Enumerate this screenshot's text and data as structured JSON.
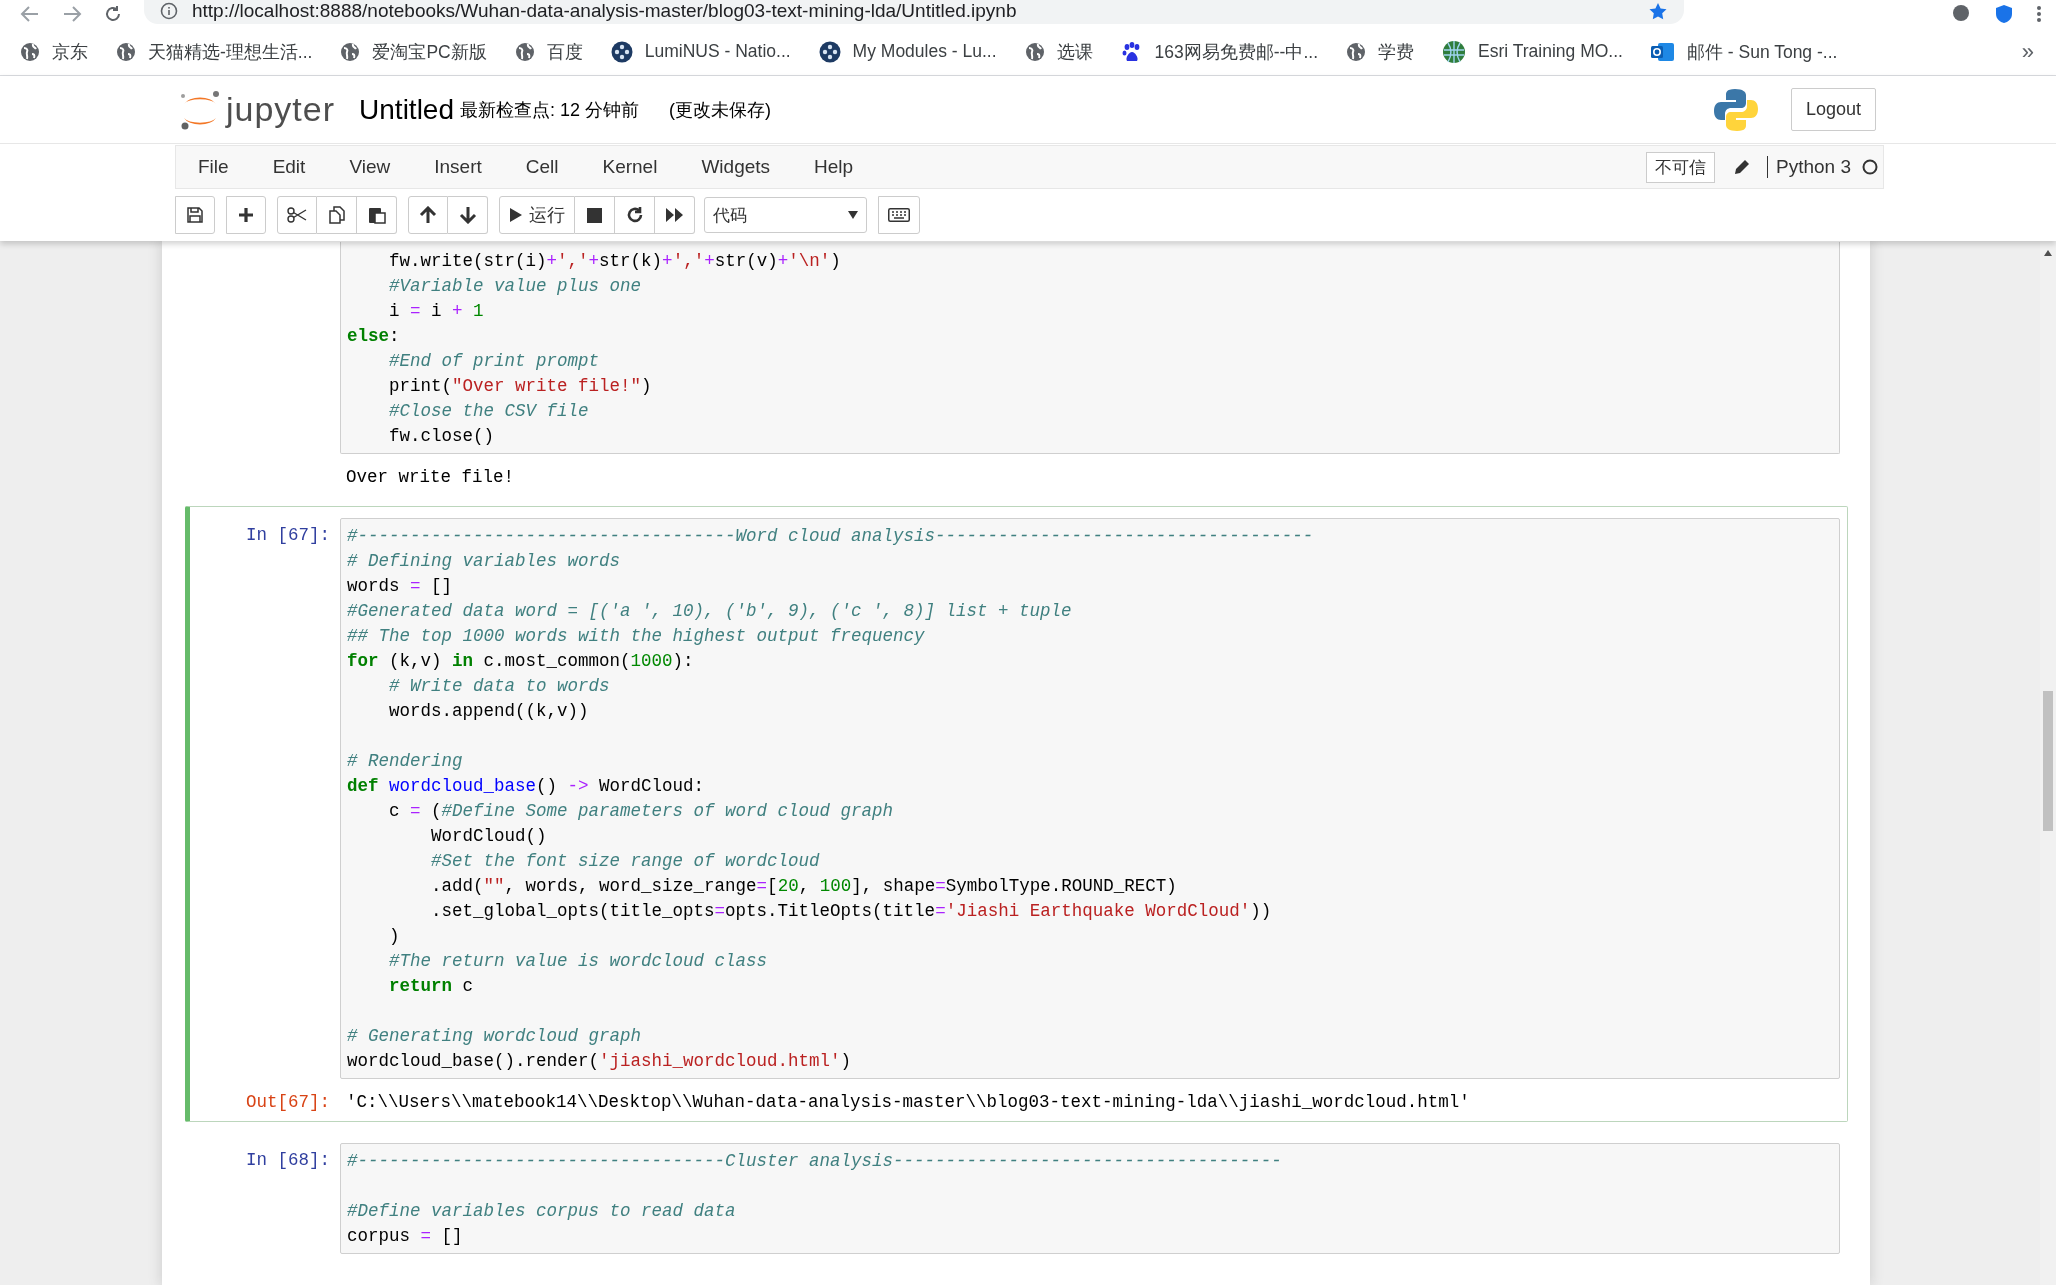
{
  "browser": {
    "url": "http://localhost:8888/notebooks/Wuhan-data-analysis-master/blog03-text-mining-lda/Untitled.ipynb",
    "bookmarks": [
      "京东",
      "天猫精选-理想生活...",
      "爱淘宝PC新版",
      "百度",
      "LumiNUS - Natio...",
      "My Modules - Lu...",
      "选课",
      "163网易免费邮--中...",
      "学费",
      "Esri Training MO...",
      "邮件 - Sun Tong -..."
    ],
    "overflow": "»"
  },
  "header": {
    "logo_text": "jupyter",
    "notebook_name": "Untitled",
    "checkpoint": "最新检查点: 12 分钟前",
    "autosave": "(更改未保存)",
    "logout": "Logout"
  },
  "menu": [
    "File",
    "Edit",
    "View",
    "Insert",
    "Cell",
    "Kernel",
    "Widgets",
    "Help"
  ],
  "kernel": {
    "trust": "不可信",
    "name": "Python 3",
    "busy": false
  },
  "toolbar": {
    "run_label": "运行",
    "cell_type": "代码"
  },
  "cells": [
    {
      "selected": false,
      "lines": [
        {
          "kind": "code",
          "tokens": [
            {
              "kind": "plain",
              "text": "    fw.write(str(i)"
            },
            {
              "kind": "op",
              "text": "+"
            },
            {
              "kind": "string",
              "text": "','"
            },
            {
              "kind": "op",
              "text": "+"
            },
            {
              "kind": "plain",
              "text": "str(k)"
            },
            {
              "kind": "op",
              "text": "+"
            },
            {
              "kind": "string",
              "text": "','"
            },
            {
              "kind": "op",
              "text": "+"
            },
            {
              "kind": "plain",
              "text": "str(v)"
            },
            {
              "kind": "op",
              "text": "+"
            },
            {
              "kind": "string",
              "text": "'\\n'"
            },
            {
              "kind": "plain",
              "text": ")"
            }
          ]
        },
        {
          "kind": "code",
          "tokens": [
            {
              "kind": "comment",
              "text": "    #Variable value plus one"
            }
          ]
        },
        {
          "kind": "code",
          "tokens": [
            {
              "kind": "plain",
              "text": "    i "
            },
            {
              "kind": "op",
              "text": "="
            },
            {
              "kind": "plain",
              "text": " i "
            },
            {
              "kind": "op",
              "text": "+"
            },
            {
              "kind": "number",
              "text": " 1"
            }
          ]
        },
        {
          "kind": "code",
          "tokens": [
            {
              "kind": "keyword",
              "text": "else"
            },
            {
              "kind": "plain",
              "text": ":"
            }
          ]
        },
        {
          "kind": "code",
          "tokens": [
            {
              "kind": "comment",
              "text": "    #End of print prompt"
            }
          ]
        },
        {
          "kind": "code",
          "tokens": [
            {
              "kind": "plain",
              "text": "    print("
            },
            {
              "kind": "string",
              "text": "\"Over write file!\""
            },
            {
              "kind": "plain",
              "text": ")"
            }
          ]
        },
        {
          "kind": "code",
          "tokens": [
            {
              "kind": "comment",
              "text": "    #Close the CSV file"
            }
          ]
        },
        {
          "kind": "code",
          "tokens": [
            {
              "kind": "plain",
              "text": "    fw.close()"
            }
          ]
        }
      ],
      "output": "Over write file!"
    },
    {
      "selected": true,
      "input_prompt": "In [67]:",
      "lines": [
        {
          "kind": "code",
          "tokens": [
            {
              "kind": "comment",
              "text": "#------------------------------------Word cloud analysis------------------------------------"
            }
          ]
        },
        {
          "kind": "code",
          "tokens": [
            {
              "kind": "comment",
              "text": "# Defining variables words"
            }
          ]
        },
        {
          "kind": "code",
          "tokens": [
            {
              "kind": "plain",
              "text": "words "
            },
            {
              "kind": "op",
              "text": "="
            },
            {
              "kind": "plain",
              "text": " []"
            }
          ]
        },
        {
          "kind": "code",
          "tokens": [
            {
              "kind": "comment",
              "text": "#Generated data word = [('a ', 10), ('b', 9), ('c ', 8)] list + tuple"
            }
          ]
        },
        {
          "kind": "code",
          "tokens": [
            {
              "kind": "comment",
              "text": "## The top 1000 words with the highest output frequency"
            }
          ]
        },
        {
          "kind": "code",
          "tokens": [
            {
              "kind": "keyword",
              "text": "for"
            },
            {
              "kind": "plain",
              "text": " (k,v) "
            },
            {
              "kind": "keyword",
              "text": "in"
            },
            {
              "kind": "plain",
              "text": " c.most_common("
            },
            {
              "kind": "number",
              "text": "1000"
            },
            {
              "kind": "plain",
              "text": "):"
            }
          ]
        },
        {
          "kind": "code",
          "tokens": [
            {
              "kind": "comment",
              "text": "    # Write data to words"
            }
          ]
        },
        {
          "kind": "code",
          "tokens": [
            {
              "kind": "plain",
              "text": "    words.append((k,v))"
            }
          ]
        },
        {
          "kind": "blank"
        },
        {
          "kind": "code",
          "tokens": [
            {
              "kind": "comment",
              "text": "# Rendering"
            }
          ]
        },
        {
          "kind": "code",
          "tokens": [
            {
              "kind": "keyword",
              "text": "def "
            },
            {
              "kind": "name",
              "text": "wordcloud_base"
            },
            {
              "kind": "plain",
              "text": "() "
            },
            {
              "kind": "op",
              "text": "->"
            },
            {
              "kind": "plain",
              "text": " WordCloud:"
            }
          ]
        },
        {
          "kind": "code",
          "tokens": [
            {
              "kind": "plain",
              "text": "    c "
            },
            {
              "kind": "op",
              "text": "="
            },
            {
              "kind": "plain",
              "text": " ("
            },
            {
              "kind": "comment",
              "text": "#Define Some parameters of word cloud graph"
            }
          ]
        },
        {
          "kind": "code",
          "tokens": [
            {
              "kind": "plain",
              "text": "        WordCloud()"
            }
          ]
        },
        {
          "kind": "code",
          "tokens": [
            {
              "kind": "comment",
              "text": "        #Set the font size range of wordcloud"
            }
          ]
        },
        {
          "kind": "code",
          "tokens": [
            {
              "kind": "plain",
              "text": "        .add("
            },
            {
              "kind": "string",
              "text": "\"\""
            },
            {
              "kind": "plain",
              "text": ", words, word_size_range"
            },
            {
              "kind": "op",
              "text": "="
            },
            {
              "kind": "plain",
              "text": "["
            },
            {
              "kind": "number",
              "text": "20"
            },
            {
              "kind": "plain",
              "text": ", "
            },
            {
              "kind": "number",
              "text": "100"
            },
            {
              "kind": "plain",
              "text": "], shape"
            },
            {
              "kind": "op",
              "text": "="
            },
            {
              "kind": "plain",
              "text": "SymbolType.ROUND_RECT)"
            }
          ]
        },
        {
          "kind": "code",
          "tokens": [
            {
              "kind": "plain",
              "text": "        .set_global_opts(title_opts"
            },
            {
              "kind": "op",
              "text": "="
            },
            {
              "kind": "plain",
              "text": "opts.TitleOpts(title"
            },
            {
              "kind": "op",
              "text": "="
            },
            {
              "kind": "string",
              "text": "'Jiashi Earthquake WordCloud'"
            },
            {
              "kind": "plain",
              "text": "))"
            }
          ]
        },
        {
          "kind": "code",
          "tokens": [
            {
              "kind": "plain",
              "text": "    )"
            }
          ]
        },
        {
          "kind": "code",
          "tokens": [
            {
              "kind": "comment",
              "text": "    #The return value is wordcloud class"
            }
          ]
        },
        {
          "kind": "code",
          "tokens": [
            {
              "kind": "keyword",
              "text": "    return"
            },
            {
              "kind": "plain",
              "text": " c"
            }
          ]
        },
        {
          "kind": "blank"
        },
        {
          "kind": "code",
          "tokens": [
            {
              "kind": "comment",
              "text": "# Generating wordcloud graph"
            }
          ]
        },
        {
          "kind": "code",
          "tokens": [
            {
              "kind": "plain",
              "text": "wordcloud_base().render("
            },
            {
              "kind": "string",
              "text": "'jiashi_wordcloud.html'"
            },
            {
              "kind": "plain",
              "text": ")"
            }
          ]
        }
      ],
      "output_prompt": "Out[67]:",
      "output": "'C:\\\\Users\\\\matebook14\\\\Desktop\\\\Wuhan-data-analysis-master\\\\blog03-text-mining-lda\\\\jiashi_wordcloud.html'"
    },
    {
      "selected": false,
      "input_prompt": "In [68]:",
      "lines": [
        {
          "kind": "code",
          "tokens": [
            {
              "kind": "comment",
              "text": "#-----------------------------------Cluster analysis-------------------------------------"
            }
          ]
        },
        {
          "kind": "blank"
        },
        {
          "kind": "code",
          "tokens": [
            {
              "kind": "comment",
              "text": "#Define variables corpus to read data"
            }
          ]
        },
        {
          "kind": "code",
          "tokens": [
            {
              "kind": "plain",
              "text": "corpus "
            },
            {
              "kind": "op",
              "text": "="
            },
            {
              "kind": "plain",
              "text": " []"
            }
          ]
        }
      ]
    }
  ]
}
